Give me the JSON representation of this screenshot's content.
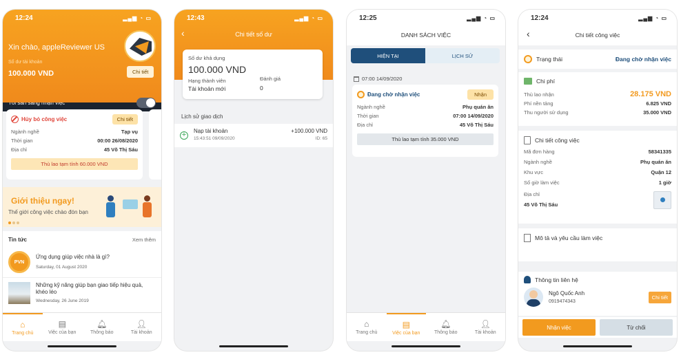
{
  "screen1": {
    "time": "12:24",
    "greeting": "Xin chào, appleReviewer US",
    "balance_label": "Số dư tài khoản",
    "balance": "100.000 VND",
    "detail_button": "Chi tiết",
    "ready_label": "Tôi sẵn sàng nhận việc",
    "job": {
      "status": "Hủy bỏ công việc",
      "detail_button": "Chi tiết",
      "rows": [
        {
          "label": "Ngành nghề",
          "value": "Tạp vụ"
        },
        {
          "label": "Thời gian",
          "value": "00:00 26/08/2020"
        },
        {
          "label": "Địa chỉ",
          "value": "45 Võ Thị Sáu"
        }
      ],
      "estimate": "Thù lao tạm tính 60.000 VND"
    },
    "banner_title": "Giới thiệu ngay!",
    "banner_sub": "Thế giới công việc chào đón bạn",
    "news_title": "Tin tức",
    "news_more": "Xem thêm",
    "news": [
      {
        "title": "Ứng dụng giúp việc nhà là gì?",
        "date": "Saturday, 01 August 2020",
        "thumb": "PVN"
      },
      {
        "title": "Những kỹ năng giúp bạn giao tiếp hiệu quả, khéo léo",
        "date": "Wednesday, 26 June 2019",
        "thumb": ""
      }
    ],
    "tabs": [
      {
        "label": "Trang chủ",
        "icon": "home-icon"
      },
      {
        "label": "Việc của bạn",
        "icon": "jobs-icon"
      },
      {
        "label": "Thông báo",
        "icon": "bell-icon"
      },
      {
        "label": "Tài khoản",
        "icon": "user-icon"
      }
    ]
  },
  "screen2": {
    "time": "12:43",
    "title": "Chi tiết số dư",
    "avail_label": "Số dư khả dụng",
    "avail": "100.000 VND",
    "rank_label": "Hạng thành viên",
    "rank": "Tài khoản mới",
    "rating_label": "Đánh giá",
    "rating": "0",
    "history_title": "Lịch sử giao dịch",
    "tx": {
      "title": "Nạp tài khoản",
      "time": "15:43:51 09/09/2020",
      "amount": "+100.000 VND",
      "id": "ID: 65"
    }
  },
  "screen3": {
    "time": "12:25",
    "title": "DANH SÁCH VIỆC",
    "tab_current": "HIỆN TẠI",
    "tab_history": "LỊCH SỬ",
    "date": "07:00 14/09/2020",
    "status": "Đang chờ nhận việc",
    "accept_button": "Nhận",
    "rows": [
      {
        "label": "Ngành nghề",
        "value": "Phụ quán ăn"
      },
      {
        "label": "Thời gian",
        "value": "07:00 14/09/2020"
      },
      {
        "label": "Địa chỉ",
        "value": "45 Võ Thị Sáu"
      }
    ],
    "estimate": "Thù lao tạm tính 35.000 VND",
    "tabs": [
      {
        "label": "Trang chủ",
        "icon": "home-icon"
      },
      {
        "label": "Việc của bạn",
        "icon": "jobs-icon"
      },
      {
        "label": "Thông báo",
        "icon": "bell-icon"
      },
      {
        "label": "Tài khoản",
        "icon": "user-icon"
      }
    ]
  },
  "screen4": {
    "time": "12:24",
    "title": "Chi tiết công việc",
    "status_label": "Trạng thái",
    "status_value": "Đang chờ nhận việc",
    "cost_title": "Chi phí",
    "cost_rows": [
      {
        "label": "Thù lao nhận",
        "value": "28.175 VND"
      },
      {
        "label": "Phí nền tảng",
        "value": "6.825 VND"
      },
      {
        "label": "Thu người sử dụng",
        "value": "35.000 VND"
      }
    ],
    "job_title": "Chi tiết công việc",
    "job_rows": [
      {
        "label": "Mã đơn hàng",
        "value": "58341335"
      },
      {
        "label": "Ngành nghề",
        "value": "Phụ quán ăn"
      },
      {
        "label": "Khu vực",
        "value": "Quận 12"
      },
      {
        "label": "Số giờ làm việc",
        "value": "1 giờ"
      }
    ],
    "address_label": "Địa chỉ",
    "address_value": "45 Võ Thị Sáu",
    "desc_title": "Mô tả và yêu cầu làm việc",
    "contact_title": "Thông tin liên hệ",
    "contact_name": "Ngô Quốc Anh",
    "contact_phone": "0919474343",
    "contact_button": "Chi tiết",
    "accept_button": "Nhận việc",
    "reject_button": "Từ chối"
  },
  "colors": {
    "accent": "#f29a1f",
    "dark": "#1c2430",
    "navy": "#1f4f7b"
  }
}
